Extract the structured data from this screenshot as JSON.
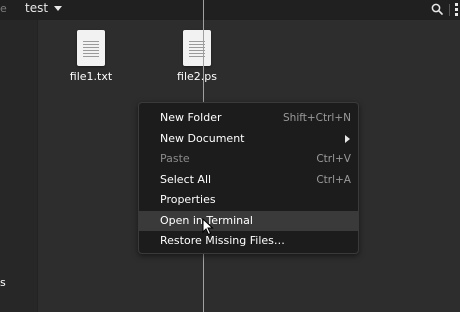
{
  "header": {
    "back_fragment": "e",
    "path_name": "test",
    "search_icon": "search-icon",
    "menu_icon": "vertical-ellipsis-icon"
  },
  "sidebar": {
    "fragment": "s"
  },
  "files": [
    {
      "name": "file1.txt",
      "icon": "text-file-icon"
    },
    {
      "name": "file2.ps",
      "icon": "text-file-icon"
    }
  ],
  "context_menu": {
    "items": [
      {
        "label": "New Folder",
        "shortcut": "Shift+Ctrl+N",
        "disabled": false,
        "submenu": false
      },
      {
        "label": "New Document",
        "shortcut": "",
        "disabled": false,
        "submenu": true
      },
      {
        "label": "Paste",
        "shortcut": "Ctrl+V",
        "disabled": true,
        "submenu": false
      },
      {
        "label": "Select All",
        "shortcut": "Ctrl+A",
        "disabled": false,
        "submenu": false
      },
      {
        "label": "Properties",
        "shortcut": "",
        "disabled": false,
        "submenu": false
      },
      {
        "label": "Open in Terminal",
        "shortcut": "",
        "disabled": false,
        "submenu": false,
        "hovered": true
      },
      {
        "label": "Restore Missing Files…",
        "shortcut": "",
        "disabled": false,
        "submenu": false
      }
    ]
  },
  "colors": {
    "background": "#2d2d2d",
    "header": "#202020",
    "menu_background": "#1c1c1c",
    "menu_hover": "#3a3a3a",
    "disabled_text": "#8a8a8a"
  }
}
